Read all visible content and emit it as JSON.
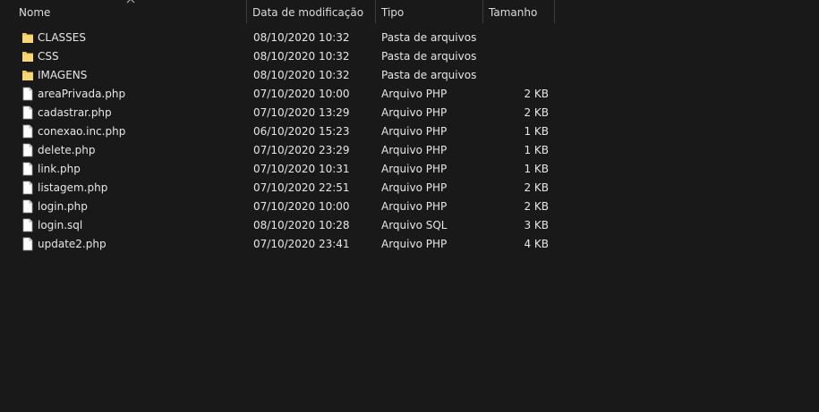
{
  "columns": {
    "name": "Nome",
    "date": "Data de modificação",
    "type": "Tipo",
    "size": "Tamanho"
  },
  "colors": {
    "background": "#191919",
    "folder": "#f5c85b",
    "text": "#e6e6e6"
  },
  "files": [
    {
      "name": "CLASSES",
      "date": "08/10/2020 10:32",
      "type": "Pasta de arquivos",
      "size": "",
      "icon": "folder-icon"
    },
    {
      "name": "CSS",
      "date": "08/10/2020 10:32",
      "type": "Pasta de arquivos",
      "size": "",
      "icon": "folder-icon"
    },
    {
      "name": "IMAGENS",
      "date": "08/10/2020 10:32",
      "type": "Pasta de arquivos",
      "size": "",
      "icon": "folder-icon"
    },
    {
      "name": "areaPrivada.php",
      "date": "07/10/2020 10:00",
      "type": "Arquivo PHP",
      "size": "2 KB",
      "icon": "file-icon"
    },
    {
      "name": "cadastrar.php",
      "date": "07/10/2020 13:29",
      "type": "Arquivo PHP",
      "size": "2 KB",
      "icon": "file-icon"
    },
    {
      "name": "conexao.inc.php",
      "date": "06/10/2020 15:23",
      "type": "Arquivo PHP",
      "size": "1 KB",
      "icon": "file-icon"
    },
    {
      "name": "delete.php",
      "date": "07/10/2020 23:29",
      "type": "Arquivo PHP",
      "size": "1 KB",
      "icon": "file-icon"
    },
    {
      "name": "link.php",
      "date": "07/10/2020 10:31",
      "type": "Arquivo PHP",
      "size": "1 KB",
      "icon": "file-icon"
    },
    {
      "name": "listagem.php",
      "date": "07/10/2020 22:51",
      "type": "Arquivo PHP",
      "size": "2 KB",
      "icon": "file-icon"
    },
    {
      "name": "login.php",
      "date": "07/10/2020 10:00",
      "type": "Arquivo PHP",
      "size": "2 KB",
      "icon": "file-icon"
    },
    {
      "name": "login.sql",
      "date": "08/10/2020 10:28",
      "type": "Arquivo SQL",
      "size": "3 KB",
      "icon": "file-icon"
    },
    {
      "name": "update2.php",
      "date": "07/10/2020 23:41",
      "type": "Arquivo PHP",
      "size": "4 KB",
      "icon": "file-icon"
    }
  ]
}
